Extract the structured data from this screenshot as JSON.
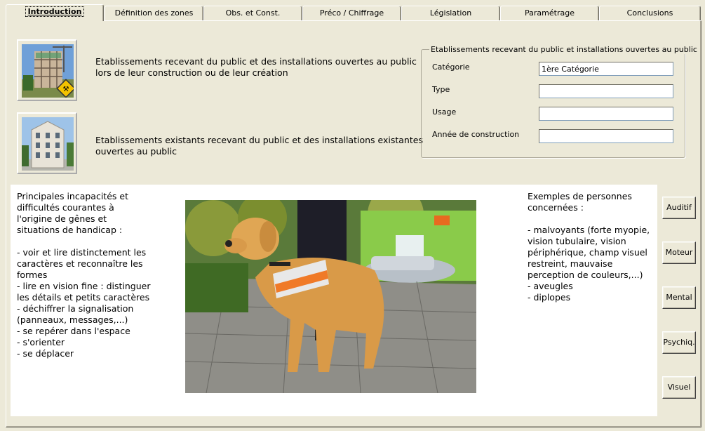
{
  "tabs": [
    {
      "label": "Introduction",
      "active": true
    },
    {
      "label": "Définition des zones"
    },
    {
      "label": "Obs. et Const."
    },
    {
      "label": "Préco / Chiffrage"
    },
    {
      "label": "Législation"
    },
    {
      "label": "Paramétrage"
    },
    {
      "label": "Conclusions"
    }
  ],
  "options": {
    "new_label": "Etablissements recevant du public et des installations ouvertes au public\nlors de leur construction ou de leur création",
    "existing_label": "Etablissements existants recevant du public et des installations existantes\nouvertes au public"
  },
  "group": {
    "title": "Etablissements recevant du public et installations ouvertes au public",
    "fields": [
      {
        "label": "Catégorie",
        "value": "1ère Catégorie"
      },
      {
        "label": "Type",
        "value": ""
      },
      {
        "label": "Usage",
        "value": ""
      },
      {
        "label": "Année de construction",
        "value": ""
      }
    ]
  },
  "content": {
    "left_text": "Principales incapacités et\ndifficultés courantes à\nl'origine de gênes et\nsituations de handicap :\n\n- voir et lire distinctement les\ncaractères et reconnaître les\nformes\n- lire en vision fine : distinguer\nles détails et petits caractères\n- déchiffrer la signalisation\n(panneaux, messages,...)\n- se repérer dans l'espace\n- s'orienter\n- se déplacer",
    "right_text": "Exemples de personnes\nconcernées :\n\n- malvoyants (forte myopie,\nvision tubulaire, vision\npériphérique, champ visuel\nrestreint, mauvaise\nperception de couleurs,...)\n- aveugles\n- diplopes"
  },
  "side_buttons": [
    "Auditif",
    "Moteur",
    "Mental",
    "Psychiq.",
    "Visuel"
  ]
}
